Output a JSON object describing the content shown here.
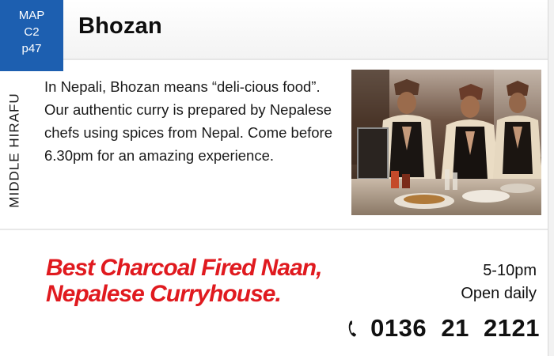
{
  "map_badge": {
    "line1": "MAP",
    "line2": "C2",
    "line3": "p47"
  },
  "restaurant": {
    "name": "Bhozan"
  },
  "area": {
    "label": "MIDDLE HIRAFU"
  },
  "description": "In Nepali, Bhozan means “deli-cious food”. Our authentic curry is prepared by Nepalese chefs using spices from Nepal. Come before 6.30pm for an amazing experience.",
  "tagline": {
    "line1": "Best Charcoal Fired Naan,",
    "line2": "Nepalese Curryhouse."
  },
  "hours": {
    "time": "5-10pm",
    "days": "Open daily"
  },
  "phone": {
    "number": "0136  21  2121",
    "icon": "phone-icon"
  },
  "colors": {
    "badge_blue": "#1d5fb0",
    "tagline_red": "#e01a1f"
  }
}
